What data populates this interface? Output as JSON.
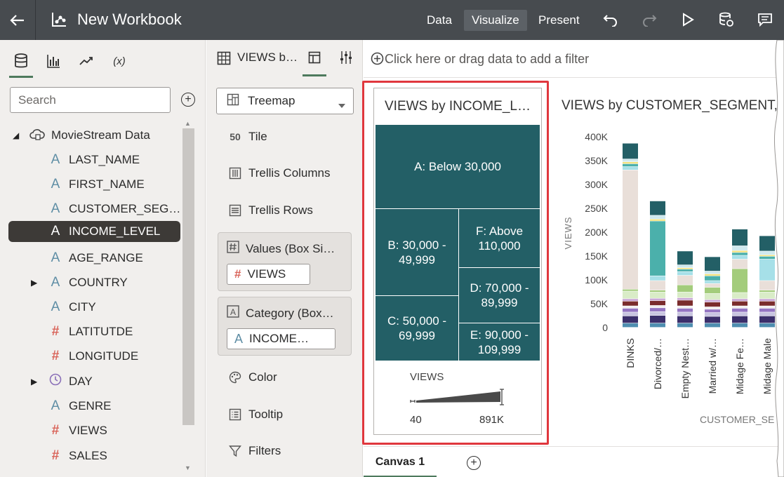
{
  "topbar": {
    "title": "New Workbook",
    "tabs": [
      {
        "label": "Data",
        "active": false
      },
      {
        "label": "Visualize",
        "active": true
      },
      {
        "label": "Present",
        "active": false
      }
    ],
    "icons": [
      "back-arrow-icon",
      "workbook-logo-icon",
      "undo-icon",
      "redo-icon",
      "play-icon",
      "refresh-data-icon",
      "comments-icon"
    ]
  },
  "left_panel": {
    "tabs": [
      "data-icon",
      "visualizations-icon",
      "analytics-icon",
      "calculations-icon"
    ],
    "calculations_tab_label": "(x)",
    "search": {
      "placeholder": "Search"
    },
    "root": "MovieStream Data",
    "items": [
      {
        "label": "LAST_NAME",
        "icon": "A"
      },
      {
        "label": "FIRST_NAME",
        "icon": "A"
      },
      {
        "label": "CUSTOMER_SEG…",
        "icon": "A"
      },
      {
        "label": "INCOME_LEVEL",
        "icon": "A"
      },
      {
        "label": "AGE_RANGE",
        "icon": "A"
      },
      {
        "label": "COUNTRY",
        "icon": "A"
      },
      {
        "label": "CITY",
        "icon": "A"
      },
      {
        "label": "LATITUTDE",
        "icon": "#"
      },
      {
        "label": "LONGITUDE",
        "icon": "#"
      },
      {
        "label": "DAY",
        "icon": "clock"
      },
      {
        "label": "GENRE",
        "icon": "A"
      },
      {
        "label": "VIEWS",
        "icon": "#"
      },
      {
        "label": "SALES",
        "icon": "#"
      }
    ]
  },
  "grammar_panel": {
    "header_title": "VIEWS b…",
    "viz_type": "Treemap",
    "tile_label": "Tile",
    "tile_icon_text": "50",
    "trellis_columns": "Trellis Columns",
    "trellis_rows": "Trellis Rows",
    "values_title": "Values (Box Si…",
    "values_pill": "VIEWS",
    "category_title": "Category (Box…",
    "category_pill": "INCOME…",
    "color": "Color",
    "tooltip": "Tooltip",
    "filters": "Filters"
  },
  "filter_bar": {
    "text": "Click here or drag data to add a filter"
  },
  "viz1": {
    "title": "VIEWS by INCOME_L…",
    "cells": [
      {
        "label": "A: Below 30,000"
      },
      {
        "label": "B: 30,000 - 49,999"
      },
      {
        "label": "F: Above 110,000"
      },
      {
        "label": "D: 70,000 - 89,999"
      },
      {
        "label": "C: 50,000 - 69,999"
      },
      {
        "label": "E: 90,000 - 109,999"
      }
    ],
    "legend": {
      "title": "VIEWS",
      "min": "40",
      "max": "891K"
    },
    "color": "#235f66"
  },
  "viz2": {
    "title": "VIEWS by CUSTOMER_SEGMENT,"
  },
  "chart_data": {
    "type": "bar",
    "stacked": true,
    "ylabel": "VIEWS",
    "xlabel": "CUSTOMER_SE",
    "ylim": [
      0,
      400000
    ],
    "yticks": [
      "0",
      "50K",
      "100K",
      "150K",
      "200K",
      "250K",
      "300K",
      "350K",
      "400K"
    ],
    "categories": [
      "DINKS",
      "Divorced/…",
      "Empty Nest…",
      "Married w/…",
      "Midage Fe…",
      "Midage Male"
    ],
    "series": [
      {
        "color": "#4f8eb0",
        "values": [
          9000,
          9000,
          9000,
          9000,
          9000,
          9000
        ]
      },
      {
        "color": "#3b2f6b",
        "values": [
          15000,
          16000,
          15000,
          14000,
          15000,
          15000
        ]
      },
      {
        "color": "#c8c4e0",
        "values": [
          8000,
          8000,
          8000,
          8000,
          8000,
          8000
        ]
      },
      {
        "color": "#9475c2",
        "values": [
          8000,
          8000,
          8000,
          7000,
          8000,
          8000
        ]
      },
      {
        "color": "#f0eeee",
        "values": [
          5000,
          5000,
          5000,
          5000,
          5000,
          5000
        ]
      },
      {
        "color": "#7a2c2c",
        "values": [
          10000,
          10000,
          12000,
          10000,
          10000,
          10000
        ]
      },
      {
        "color": "#c9a8d6",
        "values": [
          5000,
          5000,
          5000,
          5000,
          5000,
          5000
        ]
      },
      {
        "color": "#d9ecc7",
        "values": [
          16000,
          13000,
          12000,
          13000,
          13000,
          14000
        ]
      },
      {
        "color": "#a3cc7b",
        "values": [
          4000,
          4000,
          15000,
          13000,
          50000,
          4000
        ]
      },
      {
        "color": "#e9dfd9",
        "values": [
          250000,
          20000,
          20000,
          8000,
          20000,
          20000
        ]
      },
      {
        "color": "#a6e0e8",
        "values": [
          7000,
          10000,
          8000,
          6000,
          8000,
          45000
        ]
      },
      {
        "color": "#4bb0ab",
        "values": [
          6000,
          115000,
          5000,
          10000,
          6000,
          6000
        ]
      },
      {
        "color": "#f3e17a",
        "values": [
          4000,
          4000,
          3000,
          4000,
          4000,
          3000
        ]
      },
      {
        "color": "#cfe9ef",
        "values": [
          6000,
          8000,
          6000,
          6000,
          10000,
          8000
        ]
      },
      {
        "color": "#235f66",
        "values": [
          33000,
          30000,
          29000,
          30000,
          35000,
          32000
        ]
      }
    ]
  },
  "bottom": {
    "canvas_tab": "Canvas 1"
  }
}
